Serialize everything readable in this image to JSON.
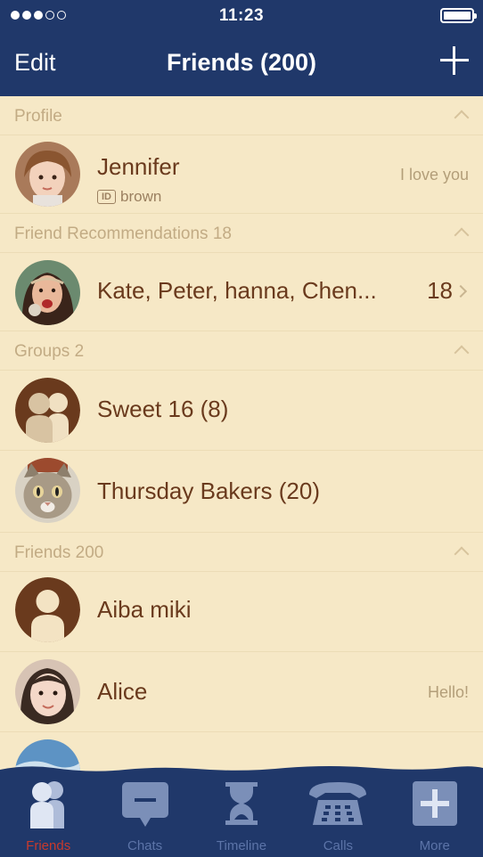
{
  "status_bar": {
    "time": "11:23"
  },
  "nav": {
    "edit_label": "Edit",
    "title": "Friends (200)"
  },
  "sections": {
    "profile": {
      "title": "Profile"
    },
    "recommendations": {
      "title": "Friend Recommendations 18"
    },
    "groups": {
      "title": "Groups 2"
    },
    "friends": {
      "title": "Friends 200"
    }
  },
  "profile": {
    "name": "Jennifer",
    "id_tag": "ID",
    "id": "brown",
    "status": "I love you"
  },
  "recommendation": {
    "names": "Kate, Peter, hanna, Chen...",
    "count": "18"
  },
  "groups": [
    {
      "name": "Sweet 16 (8)"
    },
    {
      "name": "Thursday Bakers (20)"
    }
  ],
  "friends": [
    {
      "name": "Aiba miki",
      "status": ""
    },
    {
      "name": "Alice",
      "status": "Hello!"
    }
  ],
  "tabbar": {
    "tabs": [
      {
        "label": "Friends",
        "icon": "friends-icon",
        "active": true
      },
      {
        "label": "Chats",
        "icon": "chat-bubble-icon",
        "active": false
      },
      {
        "label": "Timeline",
        "icon": "hourglass-icon",
        "active": false
      },
      {
        "label": "Calls",
        "icon": "telephone-icon",
        "active": false
      },
      {
        "label": "More",
        "icon": "plus-square-icon",
        "active": false
      }
    ]
  },
  "colors": {
    "header": "#20386a",
    "background": "#f6e8c6",
    "text_brown": "#6a3a1d",
    "section_gray": "#c2ab84",
    "tab_active": "#c83a2c",
    "tab_inactive": "#5c74a8"
  }
}
